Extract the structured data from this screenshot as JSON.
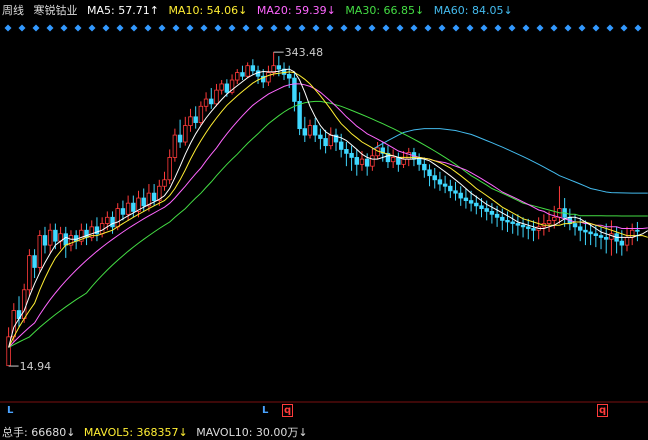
{
  "legend": {
    "period": "周线",
    "name": "寒锐钴业",
    "ma5": "MA5: 57.71↑",
    "ma10": "MA10: 54.06↓",
    "ma20": "MA20: 59.39↓",
    "ma30": "MA30: 66.85↓",
    "ma60": "MA60: 84.05↓"
  },
  "volume": {
    "total": "总手: 66680↓",
    "mavol5": "MAVOL5: 368357↓",
    "mavol10": "MAVOL10: 30.00万↓"
  },
  "annotations": {
    "high": "343.48",
    "low": "14.94"
  },
  "markers": {
    "l1": "L",
    "l2": "L",
    "q1": "q",
    "q2": "q"
  },
  "colors": {
    "up": "#ff3b3b",
    "down": "#3fd8ff",
    "ma5": "#ffffff",
    "ma10": "#ffee33",
    "ma20": "#ff66ff",
    "ma30": "#44dd44",
    "ma60": "#44bbee",
    "diamond": "#3399ff"
  },
  "chart_data": {
    "type": "candlestick",
    "series_candles": [
      [
        15,
        20,
        14.94,
        22
      ],
      [
        20,
        26,
        19,
        28
      ],
      [
        26,
        24,
        22,
        30
      ],
      [
        24,
        32,
        23,
        34
      ],
      [
        32,
        45,
        30,
        48
      ],
      [
        45,
        40,
        36,
        48
      ],
      [
        40,
        55,
        38,
        58
      ],
      [
        55,
        50,
        46,
        60
      ],
      [
        50,
        58,
        46,
        62
      ],
      [
        58,
        52,
        48,
        62
      ],
      [
        52,
        56,
        48,
        60
      ],
      [
        56,
        50,
        44,
        60
      ],
      [
        50,
        55,
        47,
        58
      ],
      [
        55,
        52,
        48,
        58
      ],
      [
        52,
        58,
        50,
        62
      ],
      [
        58,
        54,
        50,
        62
      ],
      [
        54,
        60,
        52,
        64
      ],
      [
        60,
        56,
        52,
        66
      ],
      [
        56,
        62,
        54,
        66
      ],
      [
        62,
        66,
        58,
        70
      ],
      [
        66,
        60,
        56,
        70
      ],
      [
        60,
        72,
        58,
        76
      ],
      [
        72,
        68,
        64,
        78
      ],
      [
        68,
        76,
        64,
        82
      ],
      [
        76,
        70,
        66,
        82
      ],
      [
        70,
        80,
        66,
        86
      ],
      [
        80,
        74,
        70,
        88
      ],
      [
        74,
        84,
        70,
        92
      ],
      [
        84,
        78,
        74,
        92
      ],
      [
        78,
        90,
        74,
        96
      ],
      [
        90,
        96,
        86,
        104
      ],
      [
        96,
        120,
        92,
        130
      ],
      [
        120,
        150,
        115,
        160
      ],
      [
        150,
        140,
        132,
        175
      ],
      [
        140,
        165,
        135,
        180
      ],
      [
        165,
        180,
        155,
        195
      ],
      [
        180,
        170,
        160,
        200
      ],
      [
        170,
        200,
        165,
        210
      ],
      [
        200,
        215,
        190,
        230
      ],
      [
        215,
        205,
        195,
        240
      ],
      [
        205,
        235,
        200,
        250
      ],
      [
        235,
        250,
        225,
        260
      ],
      [
        250,
        230,
        220,
        262
      ],
      [
        230,
        260,
        225,
        275
      ],
      [
        260,
        280,
        250,
        290
      ],
      [
        280,
        270,
        260,
        300
      ],
      [
        270,
        300,
        265,
        310
      ],
      [
        300,
        285,
        275,
        320
      ],
      [
        285,
        270,
        250,
        300
      ],
      [
        270,
        255,
        240,
        290
      ],
      [
        255,
        280,
        245,
        300
      ],
      [
        280,
        300,
        270,
        343.48
      ],
      [
        300,
        290,
        270,
        330
      ],
      [
        290,
        275,
        260,
        310
      ],
      [
        275,
        265,
        240,
        300
      ],
      [
        265,
        210,
        190,
        280
      ],
      [
        210,
        160,
        150,
        230
      ],
      [
        160,
        150,
        140,
        180
      ],
      [
        150,
        165,
        145,
        175
      ],
      [
        165,
        150,
        140,
        178
      ],
      [
        150,
        145,
        130,
        160
      ],
      [
        145,
        135,
        125,
        158
      ],
      [
        135,
        150,
        130,
        162
      ],
      [
        150,
        140,
        128,
        160
      ],
      [
        140,
        130,
        120,
        152
      ],
      [
        130,
        125,
        110,
        140
      ],
      [
        125,
        120,
        105,
        135
      ],
      [
        120,
        112,
        100,
        130
      ],
      [
        112,
        118,
        105,
        128
      ],
      [
        118,
        110,
        100,
        125
      ],
      [
        110,
        122,
        105,
        132
      ],
      [
        122,
        132,
        118,
        140
      ],
      [
        132,
        125,
        115,
        140
      ],
      [
        125,
        115,
        108,
        135
      ],
      [
        115,
        120,
        108,
        130
      ],
      [
        120,
        112,
        104,
        126
      ],
      [
        112,
        118,
        108,
        128
      ],
      [
        118,
        126,
        110,
        132
      ],
      [
        126,
        118,
        110,
        132
      ],
      [
        118,
        112,
        105,
        125
      ],
      [
        112,
        106,
        98,
        120
      ],
      [
        106,
        100,
        90,
        112
      ],
      [
        100,
        96,
        88,
        108
      ],
      [
        96,
        92,
        86,
        104
      ],
      [
        92,
        90,
        84,
        100
      ],
      [
        90,
        86,
        80,
        96
      ],
      [
        86,
        84,
        78,
        94
      ],
      [
        84,
        80,
        74,
        90
      ],
      [
        80,
        78,
        72,
        88
      ],
      [
        78,
        76,
        70,
        86
      ],
      [
        76,
        74,
        68,
        82
      ],
      [
        74,
        72,
        66,
        80
      ],
      [
        72,
        70,
        64,
        78
      ],
      [
        70,
        68,
        62,
        76
      ],
      [
        68,
        66,
        60,
        74
      ],
      [
        66,
        64,
        58,
        72
      ],
      [
        64,
        63,
        57,
        70
      ],
      [
        63,
        62,
        56,
        68
      ],
      [
        62,
        61,
        55,
        68
      ],
      [
        61,
        60,
        54,
        66
      ],
      [
        60,
        59,
        53,
        65
      ],
      [
        59,
        58,
        52,
        64
      ],
      [
        58,
        60,
        53,
        66
      ],
      [
        60,
        62,
        55,
        68
      ],
      [
        62,
        64,
        57,
        70
      ],
      [
        64,
        66,
        59,
        74
      ],
      [
        66,
        72,
        62,
        90
      ],
      [
        72,
        66,
        60,
        80
      ],
      [
        66,
        62,
        58,
        72
      ],
      [
        62,
        60,
        55,
        68
      ],
      [
        60,
        58,
        52,
        66
      ],
      [
        58,
        57,
        50,
        64
      ],
      [
        57,
        56,
        50,
        62
      ],
      [
        56,
        55,
        49,
        61
      ],
      [
        55,
        54,
        48,
        60
      ],
      [
        54,
        53,
        46,
        62
      ],
      [
        53,
        56,
        45,
        64
      ],
      [
        56,
        52,
        46,
        60
      ],
      [
        52,
        50,
        45,
        58
      ],
      [
        50,
        54,
        47,
        60
      ],
      [
        54,
        58,
        50,
        62
      ],
      [
        58,
        57.71,
        52,
        63
      ]
    ],
    "ma5": [
      18,
      22,
      24,
      26,
      30,
      34,
      38,
      42,
      46,
      50,
      52,
      54,
      53,
      53,
      54,
      55,
      56,
      57,
      58,
      60,
      62,
      63,
      65,
      67,
      69,
      71,
      73,
      75,
      77,
      79,
      82,
      88,
      98,
      110,
      124,
      138,
      152,
      165,
      178,
      190,
      202,
      214,
      226,
      236,
      246,
      256,
      266,
      274,
      280,
      283,
      282,
      282,
      284,
      288,
      290,
      282,
      260,
      230,
      200,
      180,
      165,
      155,
      150,
      148,
      146,
      142,
      136,
      130,
      124,
      120,
      118,
      118,
      120,
      122,
      122,
      120,
      118,
      118,
      118,
      119,
      118,
      116,
      112,
      108,
      104,
      100,
      96,
      92,
      88,
      84,
      81,
      78,
      75,
      73,
      71,
      69,
      67,
      65,
      63,
      62,
      61,
      60,
      59,
      59,
      60,
      61,
      63,
      65,
      66,
      66,
      65,
      63,
      61,
      59,
      57,
      56,
      55,
      54,
      54,
      54,
      54,
      55,
      56,
      57.71
    ],
    "ma10": [
      18,
      20,
      22,
      24,
      26,
      28,
      32,
      36,
      40,
      44,
      47,
      50,
      51,
      52,
      53,
      54,
      55,
      55,
      56,
      57,
      58,
      60,
      62,
      64,
      66,
      68,
      70,
      72,
      74,
      76,
      78,
      82,
      88,
      96,
      106,
      118,
      130,
      142,
      154,
      166,
      178,
      190,
      202,
      212,
      222,
      232,
      242,
      252,
      260,
      266,
      272,
      276,
      278,
      280,
      282,
      280,
      272,
      262,
      250,
      236,
      222,
      208,
      194,
      180,
      168,
      160,
      152,
      146,
      140,
      136,
      132,
      128,
      126,
      124,
      122,
      120,
      120,
      120,
      120,
      120,
      119,
      118,
      116,
      114,
      111,
      108,
      104,
      100,
      96,
      92,
      88,
      85,
      82,
      79,
      76,
      73,
      71,
      69,
      67,
      65,
      64,
      63,
      62,
      61,
      61,
      61,
      61,
      62,
      62,
      63,
      63,
      63,
      62,
      61,
      60,
      59,
      58,
      57,
      56,
      55,
      55,
      55,
      55,
      54.06
    ],
    "ma20": [
      18,
      19,
      20,
      21,
      22,
      23,
      25,
      27,
      29,
      31,
      33,
      35,
      37,
      39,
      41,
      43,
      45,
      47,
      49,
      51,
      53,
      55,
      57,
      59,
      61,
      63,
      65,
      67,
      69,
      71,
      73,
      76,
      80,
      85,
      90,
      96,
      102,
      108,
      116,
      124,
      132,
      142,
      152,
      162,
      172,
      182,
      192,
      202,
      210,
      218,
      226,
      232,
      238,
      244,
      248,
      250,
      250,
      248,
      244,
      238,
      230,
      220,
      210,
      200,
      190,
      180,
      172,
      164,
      158,
      152,
      148,
      144,
      140,
      136,
      132,
      128,
      126,
      124,
      122,
      120,
      119,
      118,
      116,
      115,
      114,
      112,
      110,
      108,
      106,
      103,
      100,
      97,
      94,
      91,
      88,
      85,
      83,
      81,
      79,
      77,
      75,
      73,
      71,
      70,
      68,
      67,
      66,
      65,
      64,
      63,
      63,
      62,
      62,
      61,
      61,
      60,
      60,
      60,
      59,
      59,
      59,
      59,
      59,
      59.39
    ],
    "ma30": [
      18,
      18.5,
      19,
      19.5,
      20,
      21,
      22,
      23,
      24,
      25,
      26,
      27,
      28,
      29,
      30,
      31,
      33,
      35,
      37,
      39,
      41,
      43,
      45,
      47,
      49,
      51,
      53,
      55,
      57,
      59,
      61,
      63,
      66,
      69,
      72,
      76,
      80,
      84,
      89,
      94,
      100,
      106,
      112,
      118,
      124,
      131,
      138,
      145,
      152,
      160,
      168,
      175,
      182,
      189,
      195,
      200,
      204,
      207,
      209,
      210,
      210,
      208,
      206,
      203,
      200,
      196,
      192,
      188,
      184,
      180,
      176,
      172,
      168,
      164,
      160,
      156,
      152,
      148,
      144,
      140,
      136,
      132,
      128,
      124,
      120,
      116,
      112,
      108,
      104,
      100,
      97,
      94,
      91,
      88,
      86,
      84,
      82,
      80,
      78,
      76,
      75,
      74,
      73,
      72,
      71,
      70,
      69,
      69,
      68,
      68,
      67,
      67,
      67,
      67,
      67,
      66.9,
      66.9,
      66.9,
      66.85,
      66.85,
      66.85,
      66.85,
      66.85,
      66.85
    ],
    "ma60": [
      null,
      null,
      null,
      null,
      null,
      null,
      null,
      null,
      null,
      null,
      null,
      null,
      null,
      null,
      null,
      null,
      null,
      null,
      null,
      null,
      null,
      null,
      null,
      null,
      null,
      null,
      null,
      null,
      null,
      null,
      null,
      null,
      null,
      null,
      null,
      null,
      null,
      null,
      null,
      null,
      null,
      null,
      null,
      null,
      null,
      null,
      null,
      null,
      null,
      null,
      null,
      null,
      null,
      null,
      null,
      null,
      null,
      null,
      null,
      null,
      null,
      null,
      null,
      null,
      null,
      null,
      null,
      null,
      null,
      null,
      130,
      134,
      138,
      142,
      146,
      150,
      154,
      156,
      158,
      159,
      160,
      160,
      160,
      160,
      159,
      158,
      157,
      155,
      153,
      151,
      148,
      145,
      142,
      139,
      136,
      133,
      130,
      127,
      124,
      121,
      118,
      115,
      112,
      109,
      106,
      103,
      100,
      98,
      96,
      94,
      92,
      90,
      88,
      87,
      86,
      85,
      84.5,
      84.3,
      84.2,
      84.1,
      84.05,
      84.05,
      84.05,
      84.05
    ],
    "ylim_log": [
      12,
      420
    ]
  }
}
